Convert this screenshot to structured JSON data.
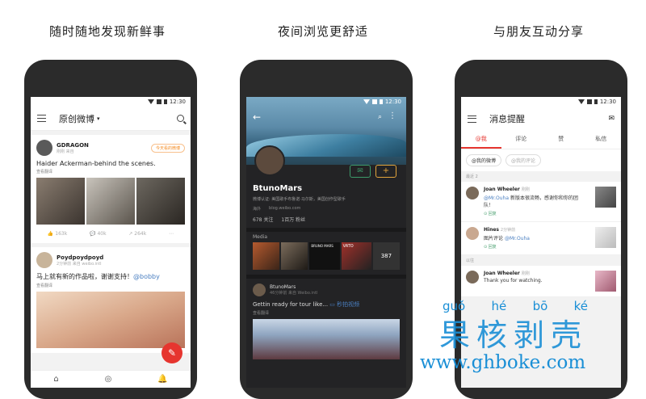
{
  "captions": [
    "随时随地发现新鲜事",
    "夜间浏览更舒适",
    "与朋友互动分享"
  ],
  "status_time": "12:30",
  "phone1": {
    "title": "原创微博",
    "card1": {
      "user": "GDRAGON",
      "meta": "刚刚  来自",
      "pill": "今天看的微博",
      "text": "Haider Ackerman-behind the scenes.",
      "translate": "查看翻译",
      "counts": [
        "163k",
        "40k",
        "264k"
      ]
    },
    "card2": {
      "user": "Poydpoydpoyd",
      "meta": "2分钟前  来自 weibo.intl",
      "text": "马上就有新的作品啦，谢谢支持！",
      "mention": "@bobby",
      "translate": "查看翻译"
    },
    "fab_icon": "✎"
  },
  "phone2": {
    "name": "BtunoMars",
    "verify": "微博认证: 美国歌手布鲁诺·马尔斯，美国创作型歌手",
    "location": "海外",
    "blog": "blog.weibo.com",
    "follow": "678 关注",
    "fans": "1百万 粉丝",
    "media_label": "Media",
    "media_count": "387",
    "media_captions": [
      "BRUNO MARS",
      "VATO"
    ],
    "post_user": "BtunoMars",
    "post_meta": "46分钟前  来自 Weibo.intl",
    "post_text": "Gettin ready for tour like...",
    "post_link": "秒拍视频",
    "post_translate": "查看翻译"
  },
  "phone3": {
    "title": "消息提醒",
    "tabs": [
      "@我",
      "评论",
      "赞",
      "私信"
    ],
    "chips": [
      "@我的微博",
      "@我的评论"
    ],
    "section": "最近 2",
    "msg1": {
      "user": "Joan Wheeler",
      "time": "刚刚",
      "mention": "@Mr.Ouha",
      "text": "新版本很流畅，感谢你和你的团队！",
      "reply": "回复"
    },
    "msg2": {
      "user": "Hines",
      "time": "2分钟前",
      "text": "图片评论",
      "mention": "@Mr.Ouha",
      "reply": "回复"
    },
    "section2": "以往",
    "msg3": {
      "user": "Joan Wheeler",
      "time": "刚刚",
      "text": "Thank you for watching."
    }
  },
  "watermark": {
    "pinyin": [
      "guǒ",
      "hé",
      "bō",
      "ké"
    ],
    "hanzi": "果核剥壳",
    "url": "www.ghboke.com"
  }
}
